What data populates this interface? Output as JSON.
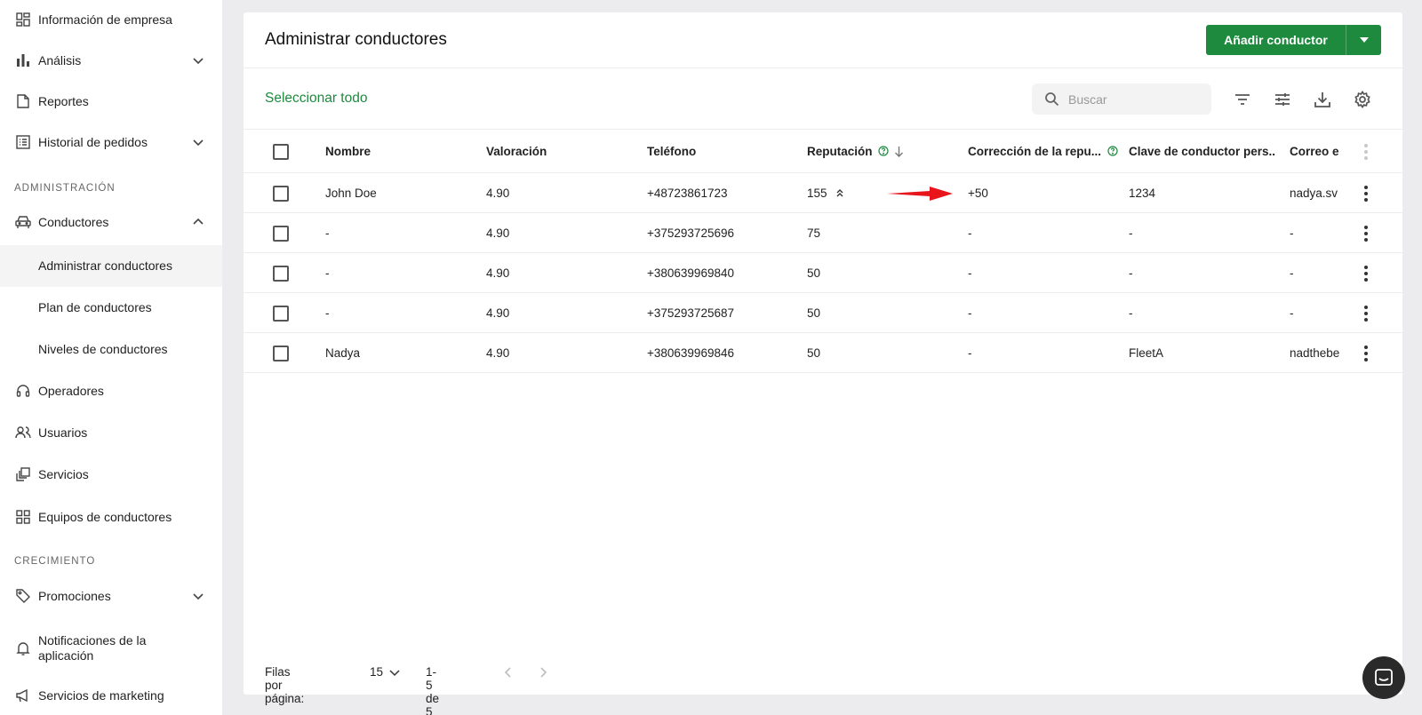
{
  "sidebar": {
    "items": [
      {
        "label": "Información de empresa",
        "icon": "dashboard-icon"
      },
      {
        "label": "Análisis",
        "icon": "bar-chart-icon"
      },
      {
        "label": "Reportes",
        "icon": "document-icon"
      },
      {
        "label": "Historial de pedidos",
        "icon": "list-icon"
      },
      {
        "label": "Conductores",
        "icon": "car-icon"
      },
      {
        "label": "Administrar conductores"
      },
      {
        "label": "Plan de conductores"
      },
      {
        "label": "Niveles de conductores"
      },
      {
        "label": "Operadores",
        "icon": "headset-icon"
      },
      {
        "label": "Usuarios",
        "icon": "users-icon"
      },
      {
        "label": "Servicios",
        "icon": "services-icon"
      },
      {
        "label": "Equipos de conductores",
        "icon": "grid-icon"
      },
      {
        "label": "Promociones",
        "icon": "tag-icon"
      },
      {
        "label": "Notificaciones de la aplicación",
        "icon": "bell-icon"
      },
      {
        "label": "Servicios de marketing",
        "icon": "megaphone-icon"
      }
    ],
    "sections": {
      "admin": "ADMINISTRACIÓN",
      "growth": "CRECIMIENTO"
    }
  },
  "header": {
    "title": "Administrar conductores",
    "add_label": "Añadir conductor"
  },
  "toolbar": {
    "select_all": "Seleccionar todo",
    "search_placeholder": "Buscar"
  },
  "table": {
    "columns": [
      "Nombre",
      "Valoración",
      "Teléfono",
      "Reputación",
      "Corrección de la repu...",
      "Clave de conductor pers...",
      "Correo el"
    ],
    "rows": [
      {
        "name": "John Doe",
        "rating": "4.90",
        "phone": "+48723861723",
        "reputation": "155",
        "correction": "+50",
        "key": "1234",
        "email": "nadya.sv"
      },
      {
        "name": "-",
        "rating": "4.90",
        "phone": "+375293725696",
        "reputation": "75",
        "correction": "-",
        "key": "-",
        "email": "-"
      },
      {
        "name": "-",
        "rating": "4.90",
        "phone": "+380639969840",
        "reputation": "50",
        "correction": "-",
        "key": "-",
        "email": "-"
      },
      {
        "name": "-",
        "rating": "4.90",
        "phone": "+375293725687",
        "reputation": "50",
        "correction": "-",
        "key": "-",
        "email": "-"
      },
      {
        "name": "Nadya",
        "rating": "4.90",
        "phone": "+380639969846",
        "reputation": "50",
        "correction": "-",
        "key": "FleetA",
        "email": "nadthebe"
      }
    ]
  },
  "footer": {
    "rows_per_page_label": "Filas por página:",
    "rows_per_page": "15",
    "range": "1-5 de 5"
  },
  "colors": {
    "accent": "#1e8a3e",
    "arrow": "#e8151b"
  }
}
